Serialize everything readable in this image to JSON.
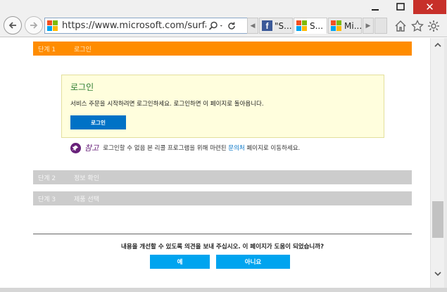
{
  "browser": {
    "url": "https://www.microsoft.com/surface/k",
    "tabs": [
      {
        "label": "\"S..."
      },
      {
        "label": "S..."
      },
      {
        "label": "Mi..."
      }
    ],
    "tab_close": "×",
    "window_close": "✕"
  },
  "steps": [
    {
      "number": "단계 1",
      "title": "로그인"
    },
    {
      "number": "단계 2",
      "title": "정보 확인"
    },
    {
      "number": "단계 3",
      "title": "제품 선택"
    }
  ],
  "login": {
    "title": "로그인",
    "description": "서비스 주문을 시작하려면 로그인하세요. 로그인하면 이 페이지로 돌아옵니다.",
    "button": "로그인"
  },
  "note": {
    "label": "참고",
    "text_before": "로그인할 수 없음 본 리콜 프로그램을 위해 마련된",
    "link": "문의처",
    "text_after": "페이지로 이동하세요."
  },
  "feedback": {
    "question": "내용을 개선할 수 있도록 의견을 보내 주십시오. 이 페이지가 도움이 되었습니까?",
    "yes": "예",
    "no": "아니요"
  },
  "colors": {
    "step_active": "#ff8c00",
    "step_inactive": "#cccccc",
    "login_button": "#0072c6",
    "feedback_button": "#00a4ef",
    "note_accent": "#68217a"
  }
}
